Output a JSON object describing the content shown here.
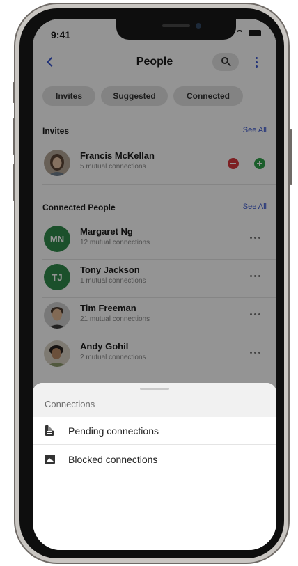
{
  "status_bar": {
    "time": "9:41"
  },
  "header": {
    "title": "People",
    "back_icon": "chevron-left-icon",
    "search_icon": "search-icon",
    "more_icon": "more-vertical-icon"
  },
  "tabs": [
    {
      "label": "Invites"
    },
    {
      "label": "Suggested"
    },
    {
      "label": "Connected"
    }
  ],
  "invites": {
    "title": "Invites",
    "see_all": "See All",
    "items": [
      {
        "name": "Francis McKellan",
        "mutual": "5 mutual connections"
      }
    ]
  },
  "connected": {
    "title": "Connected People",
    "see_all": "See All",
    "items": [
      {
        "initials": "MN",
        "name": "Margaret Ng",
        "mutual": "12 mutual connections"
      },
      {
        "initials": "TJ",
        "name": "Tony Jackson",
        "mutual": "1 mutual connections"
      },
      {
        "name": "Tim Freeman",
        "mutual": "21 mutual connections"
      },
      {
        "name": "Andy Gohil",
        "mutual": "2 mutual connections"
      }
    ]
  },
  "bottom_sheet": {
    "title": "Connections",
    "items": [
      {
        "label": "Pending connections",
        "icon": "document-icon"
      },
      {
        "label": "Blocked connections",
        "icon": "image-icon"
      }
    ]
  },
  "colors": {
    "accent": "#3a56d0",
    "initials_avatar": "#2f8a4a",
    "reject": "#d8383d",
    "accept": "#2fa24a"
  }
}
